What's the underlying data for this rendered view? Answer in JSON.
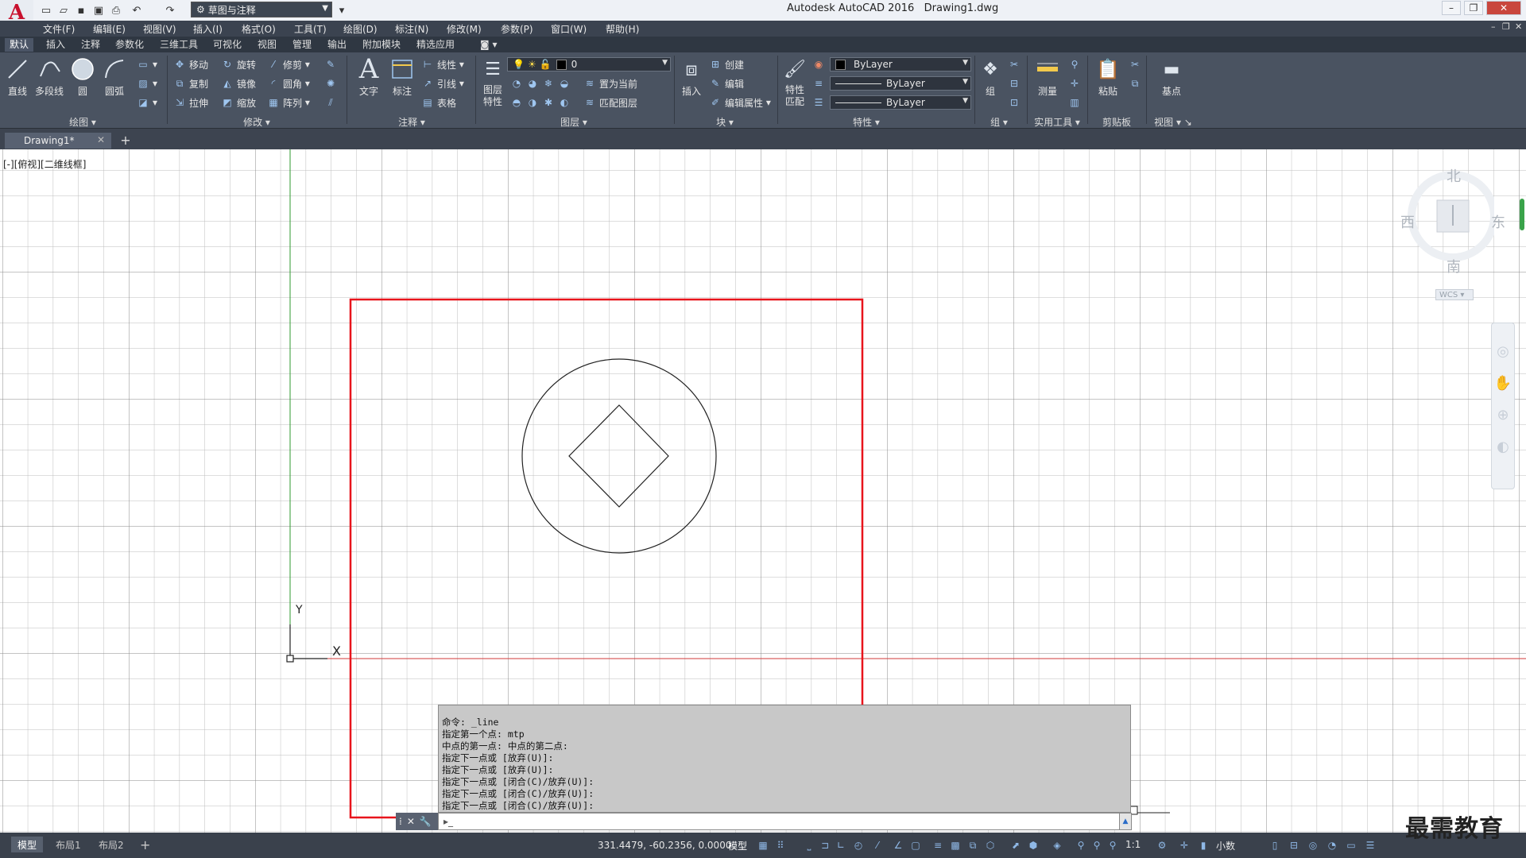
{
  "app": {
    "title": "Autodesk AutoCAD 2016",
    "filename": "Drawing1.dwg",
    "logo_letter": "A",
    "workspace": "草图与注释"
  },
  "menu": [
    "文件(F)",
    "编辑(E)",
    "视图(V)",
    "插入(I)",
    "格式(O)",
    "工具(T)",
    "绘图(D)",
    "标注(N)",
    "修改(M)",
    "参数(P)",
    "窗口(W)",
    "帮助(H)"
  ],
  "ribbon_tabs": [
    "默认",
    "插入",
    "注释",
    "参数化",
    "三维工具",
    "可视化",
    "视图",
    "管理",
    "输出",
    "附加模块",
    "精选应用"
  ],
  "ribbon": {
    "draw": {
      "title": "绘图",
      "line": "直线",
      "polyline": "多段线",
      "circle": "圆",
      "arc": "圆弧"
    },
    "modify": {
      "title": "修改",
      "move": "移动",
      "rotate": "旋转",
      "trim": "修剪",
      "copy": "复制",
      "mirror": "镜像",
      "fillet": "圆角",
      "stretch": "拉伸",
      "scale": "缩放",
      "array": "阵列"
    },
    "annotation": {
      "title": "注释",
      "text": "文字",
      "dimension": "标注",
      "linear": "线性",
      "leader": "引线",
      "table": "表格"
    },
    "layers": {
      "title": "图层",
      "layer_props": "图层\n特性",
      "current_layer": "0",
      "set_current": "置为当前",
      "match_layer": "匹配图层"
    },
    "block": {
      "title": "块",
      "insert": "插入",
      "create": "创建",
      "edit": "编辑",
      "edit_attr": "编辑属性"
    },
    "properties": {
      "title": "特性",
      "match": "特性\n匹配",
      "color": "ByLayer",
      "linetype": "ByLayer",
      "lineweight": "ByLayer"
    },
    "groups": {
      "title": "组",
      "group": "组"
    },
    "utilities": {
      "title": "实用工具",
      "measure": "测量"
    },
    "clipboard": {
      "title": "剪贴板",
      "paste": "粘贴"
    },
    "view": {
      "title": "视图",
      "base": "基点"
    }
  },
  "file_tab": "Drawing1*",
  "viewport_label": "[-][俯视][二维线框]",
  "viewcube": {
    "north": "北",
    "south": "南",
    "east": "东",
    "west": "西",
    "wcs": "WCS"
  },
  "ucs": {
    "x": "X",
    "y": "Y"
  },
  "command_history": [
    "命令: _line",
    "指定第一个点: mtp",
    "中点的第一点: 中点的第二点:",
    "指定下一点或 [放弃(U)]:",
    "指定下一点或 [放弃(U)]:",
    "指定下一点或 [闭合(C)/放弃(U)]:",
    "指定下一点或 [闭合(C)/放弃(U)]:",
    "指定下一点或 [闭合(C)/放弃(U)]:"
  ],
  "layout_tabs": [
    "模型",
    "布局1",
    "布局2"
  ],
  "status": {
    "coords": "331.4479, -60.2356, 0.0000",
    "model": "模型",
    "scale": "1:1",
    "units": "小数"
  },
  "watermark": "最需教育",
  "colors": {
    "highlight_box": "#e8141c",
    "axis_x": "#d23a3a",
    "axis_y": "#2e9a2e",
    "grid": "#3c3c3c"
  }
}
